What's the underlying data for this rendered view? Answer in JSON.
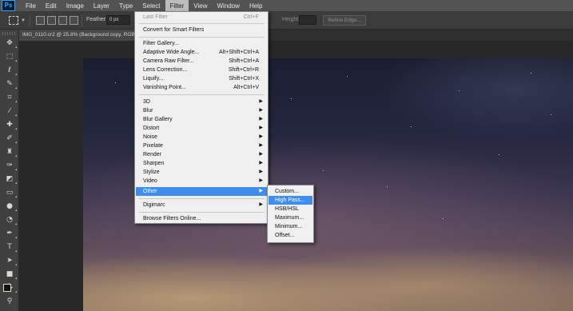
{
  "app": {
    "logo": "Ps"
  },
  "menubar": {
    "items": [
      "File",
      "Edit",
      "Image",
      "Layer",
      "Type",
      "Select",
      "Filter",
      "View",
      "Window",
      "Help"
    ],
    "active": "Filter"
  },
  "options": {
    "feather_label": "Feather:",
    "feather_value": "0 px",
    "height_label": "Height:",
    "refine_edge": "Refine Edge..."
  },
  "document": {
    "tab_title": "IMG_0110.cr2 @ 25.8% (Background copy, RGB/"
  },
  "filter_menu": {
    "last_filter": {
      "label": "Last Filter",
      "shortcut": "Ctrl+F"
    },
    "convert_smart": "Convert for Smart Filters",
    "group1": [
      {
        "label": "Filter Gallery...",
        "shortcut": ""
      },
      {
        "label": "Adaptive Wide Angle...",
        "shortcut": "Alt+Shift+Ctrl+A"
      },
      {
        "label": "Camera Raw Filter...",
        "shortcut": "Shift+Ctrl+A"
      },
      {
        "label": "Lens Correction...",
        "shortcut": "Shift+Ctrl+R"
      },
      {
        "label": "Liquify...",
        "shortcut": "Shift+Ctrl+X"
      },
      {
        "label": "Vanishing Point...",
        "shortcut": "Alt+Ctrl+V"
      }
    ],
    "submenus": [
      "3D",
      "Blur",
      "Blur Gallery",
      "Distort",
      "Noise",
      "Pixelate",
      "Render",
      "Sharpen",
      "Stylize",
      "Video",
      "Other"
    ],
    "highlighted": "Other",
    "digimarc": "Digimarc",
    "browse": "Browse Filters Online..."
  },
  "other_submenu": {
    "items": [
      "Custom...",
      "High Pass...",
      "HSB/HSL",
      "Maximum...",
      "Minimum...",
      "Offset..."
    ],
    "highlighted": "High Pass..."
  },
  "colors": {
    "menu_highlight": "#3e8ef0",
    "ps_blue": "#31a8ff"
  }
}
